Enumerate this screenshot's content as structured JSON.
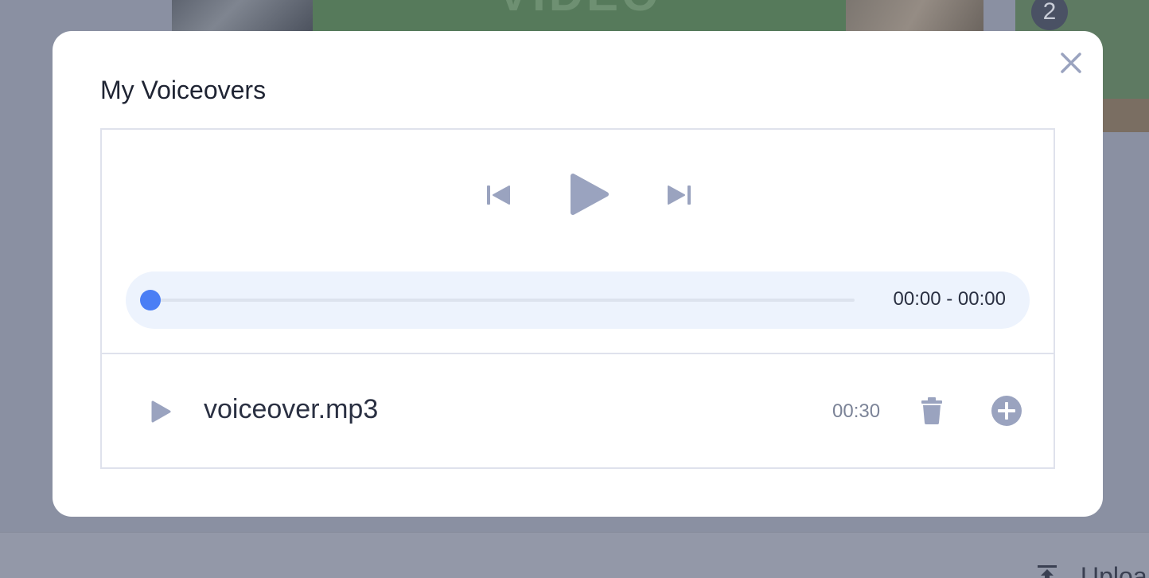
{
  "background": {
    "thumbnail_text": "VIDEO",
    "badge_number": "2",
    "upload_label": "Uploa"
  },
  "modal": {
    "title": "My Voiceovers",
    "player": {
      "time_readout": "00:00 - 00:00",
      "progress_fraction": 0
    },
    "tracks": [
      {
        "name": "voiceover.mp3",
        "duration": "00:30"
      }
    ]
  },
  "icons": {
    "close": "close-icon",
    "prev": "skip-previous-icon",
    "play": "play-icon",
    "next": "skip-next-icon",
    "delete": "trash-icon",
    "add": "add-circle-icon",
    "upload": "upload-icon"
  },
  "colors": {
    "accent": "#4a7ef5",
    "icon_gray": "#9aa3bf",
    "overlay": "#8a90a2"
  }
}
